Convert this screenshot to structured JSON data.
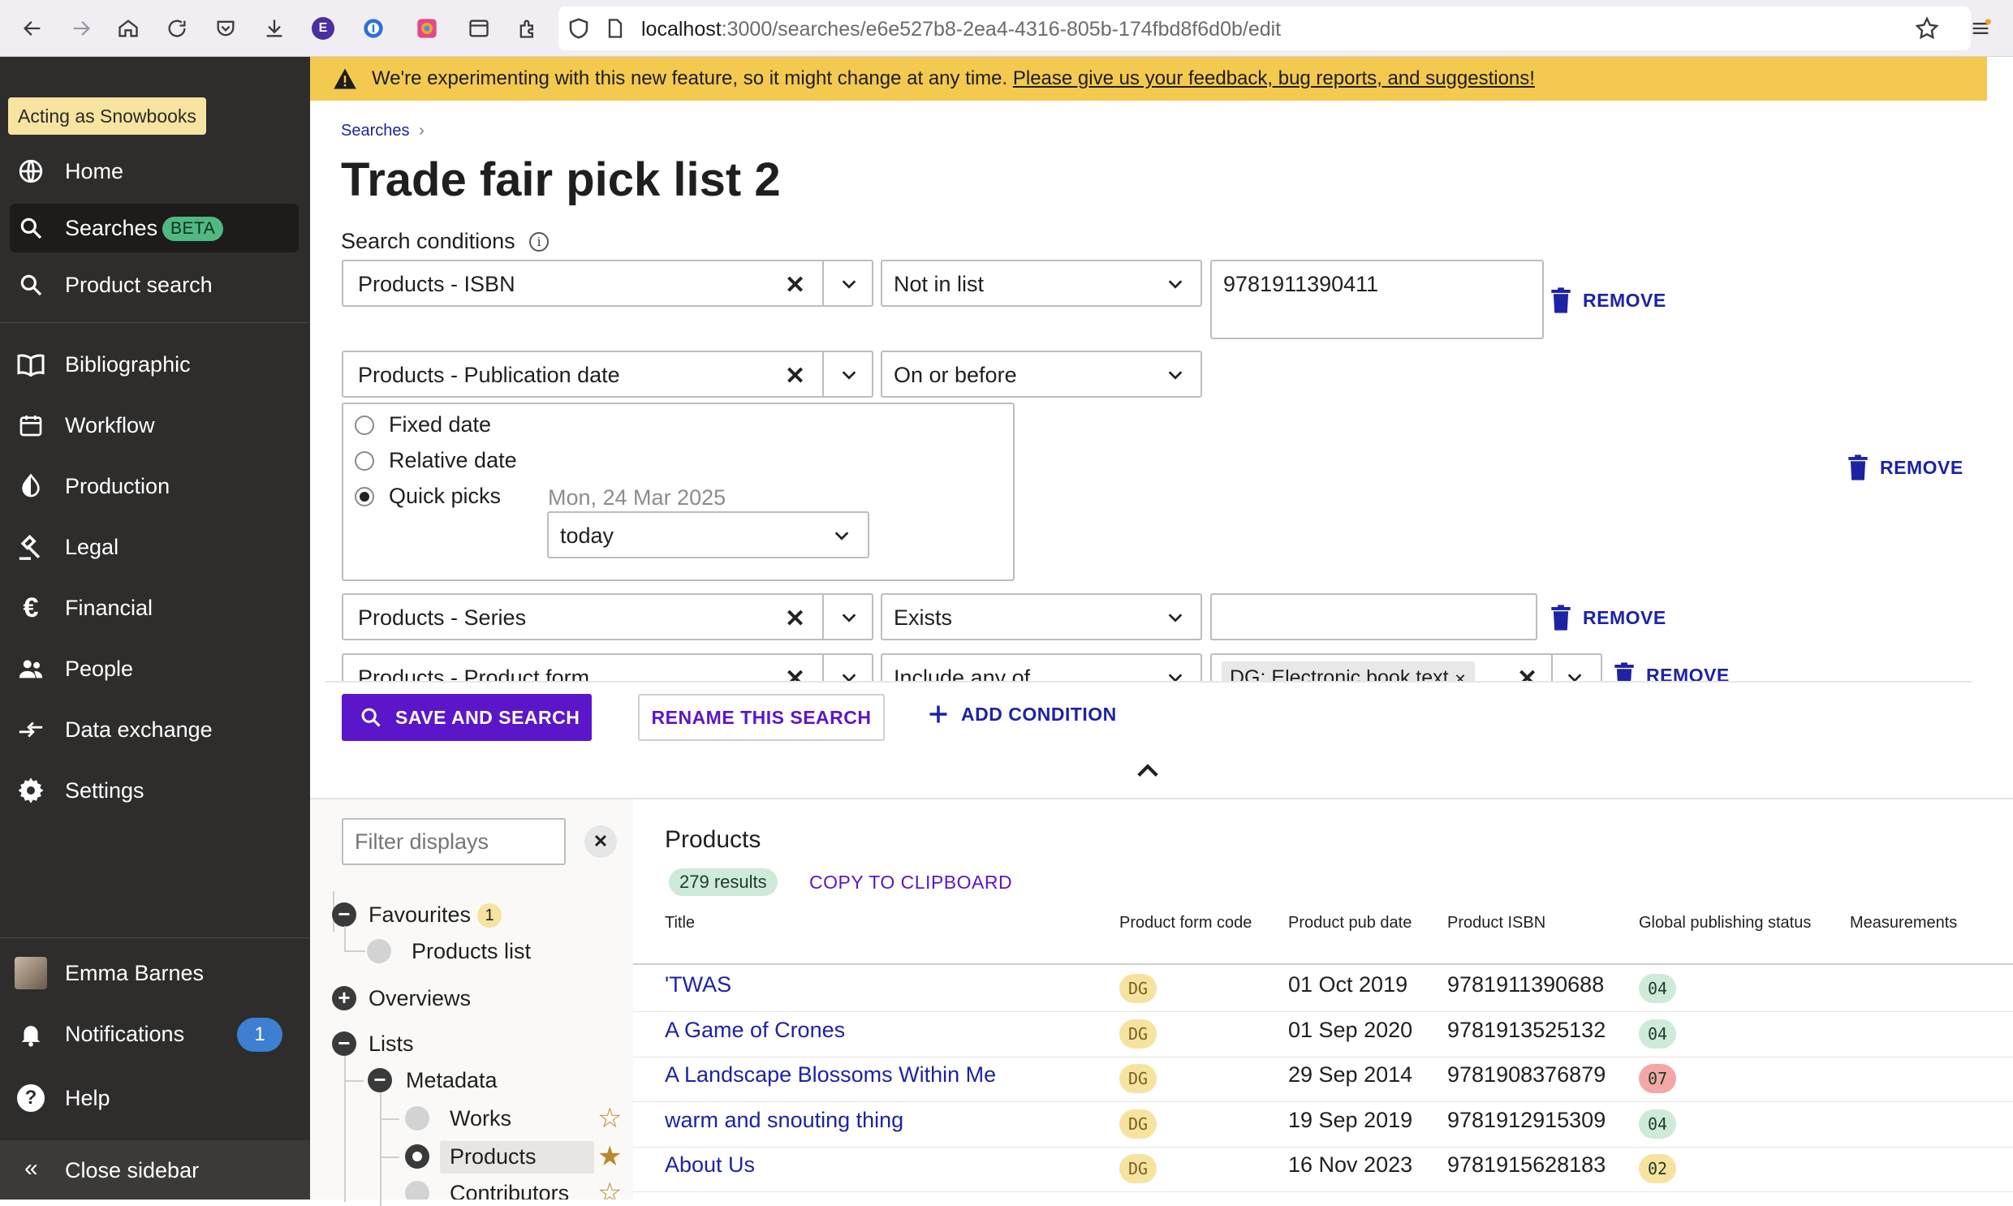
{
  "browser": {
    "url_host": "localhost",
    "url_path": ":3000/searches/e6e527b8-2ea4-4316-805b-174fbd8f6d0b/edit",
    "extension_letter": "E"
  },
  "sidebar": {
    "acting_as": "Acting as Snowbooks",
    "items": [
      {
        "label": "Home",
        "icon": "globe-icon"
      },
      {
        "label": "Searches",
        "icon": "search-icon",
        "badge": "BETA",
        "selected": true
      },
      {
        "label": "Product search",
        "icon": "search-icon"
      },
      {
        "label": "Bibliographic",
        "icon": "book-icon"
      },
      {
        "label": "Workflow",
        "icon": "calendar-icon"
      },
      {
        "label": "Production",
        "icon": "contrast-icon"
      },
      {
        "label": "Legal",
        "icon": "gavel-icon"
      },
      {
        "label": "Financial",
        "icon": "euro-icon"
      },
      {
        "label": "People",
        "icon": "people-icon"
      },
      {
        "label": "Data exchange",
        "icon": "exchange-icon"
      },
      {
        "label": "Settings",
        "icon": "gear-icon"
      }
    ],
    "user_name": "Emma Barnes",
    "notifications_label": "Notifications",
    "notifications_count": "1",
    "help_label": "Help",
    "close_label": "Close sidebar",
    "close_glyph": "«"
  },
  "banner": {
    "text": "We're experimenting with this new feature, so it might change at any time. ",
    "link": "Please give us your feedback, bug reports, and suggestions!"
  },
  "page": {
    "breadcrumb": "Searches",
    "breadcrumb_sep": "›",
    "title": "Trade fair pick list 2",
    "conditions_label": "Search conditions",
    "info_glyph": "i"
  },
  "conditions": {
    "c1": {
      "field": "Products - ISBN",
      "operator": "Not in list",
      "value": "9781911390411",
      "remove": "REMOVE"
    },
    "c2": {
      "field": "Products - Publication date",
      "operator": "On or before",
      "remove": "REMOVE",
      "options": [
        "Fixed date",
        "Relative date",
        "Quick picks"
      ],
      "selected_option": "Quick picks",
      "date_hint": "Mon, 24 Mar 2025",
      "quick_pick": "today"
    },
    "c3": {
      "field": "Products - Series",
      "operator": "Exists",
      "value": "",
      "remove": "REMOVE"
    },
    "c4": {
      "field": "Products - Product form",
      "operator": "Include any of",
      "chip": "DG: Electronic book text",
      "remove": "REMOVE"
    }
  },
  "actions": {
    "save": "SAVE AND SEARCH",
    "rename": "RENAME THIS SEARCH",
    "add": "ADD CONDITION"
  },
  "displays": {
    "filter_placeholder": "Filter displays",
    "favourites": "Favourites",
    "favourites_count": "1",
    "products_list": "Products list",
    "overviews": "Overviews",
    "lists": "Lists",
    "metadata": "Metadata",
    "works": "Works",
    "products": "Products",
    "contributors": "Contributors"
  },
  "results": {
    "title": "Products",
    "count": "279 results",
    "copy": "COPY TO CLIPBOARD",
    "columns": [
      "Title",
      "Product form code",
      "Product pub date",
      "Product ISBN",
      "Global publishing status",
      "Measurements"
    ],
    "rows": [
      {
        "title": "'TWAS",
        "form": "DG",
        "date": "01 Oct 2019",
        "isbn": "9781911390688",
        "status": "04"
      },
      {
        "title": "A Game of Crones",
        "form": "DG",
        "date": "01 Sep 2020",
        "isbn": "9781913525132",
        "status": "04"
      },
      {
        "title": "A Landscape Blossoms Within Me",
        "form": "DG",
        "date": "29 Sep 2014",
        "isbn": "9781908376879",
        "status": "07"
      },
      {
        "title": "warm and snouting thing",
        "form": "DG",
        "date": "19 Sep 2019",
        "isbn": "9781912915309",
        "status": "04"
      },
      {
        "title": "About Us",
        "form": "DG",
        "date": "16 Nov 2023",
        "isbn": "9781915628183",
        "status": "02"
      }
    ]
  },
  "colors": {
    "accent": "#5b16c9",
    "link": "#1d23a3",
    "banner": "#f3c94f",
    "sidebar": "#2e2d2c",
    "status_04": "#cdebd8",
    "status_07": "#f3a7a7",
    "status_02": "#f7e3a0"
  }
}
